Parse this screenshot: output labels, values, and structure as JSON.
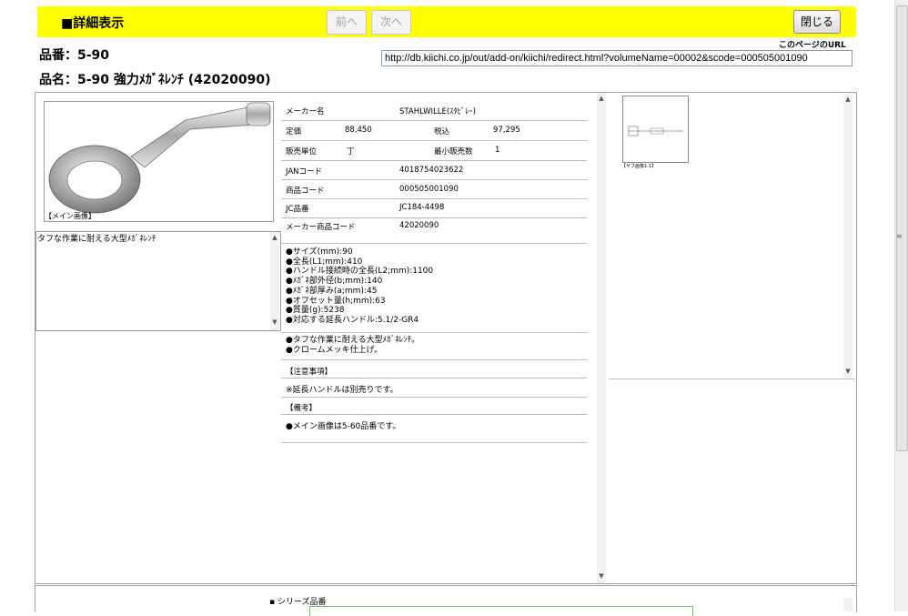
{
  "header": {
    "title": "■詳細表示",
    "prev_label": "前へ",
    "next_label": "次へ",
    "close_label": "閉じる"
  },
  "product": {
    "code_line": "品番：5-90",
    "name_line": "品名：5-90 強力ﾒｶﾞﾈﾚﾝﾁ (42020090)"
  },
  "page_url": {
    "label": "このページのURL",
    "value": "http://db.kiichi.co.jp/out/add-on/kiichi/redirect.html?volumeName=00002&scode=000505001090"
  },
  "main_image": {
    "caption": "【メイン画像】"
  },
  "description": "タフな作業に耐える大型ﾒｶﾞﾈﾚﾝﾁ",
  "details": {
    "maker_label": "メーカー名",
    "maker_value": "STAHLWILLE(ｽﾀﾋﾞﾚｰ)",
    "list_price_label": "定価",
    "list_price_value": "88,450",
    "tax_label": "税込",
    "tax_value": "97,295",
    "unit_label": "販売単位",
    "unit_value": "丁",
    "min_qty_label": "最小販売数",
    "min_qty_value": "1",
    "jan_label": "JANコード",
    "jan_value": "4018754023622",
    "item_code_label": "商品コード",
    "item_code_value": "000505001090",
    "jc_label": "JC品番",
    "jc_value": "JC184-4498",
    "maker_code_label": "メーカー商品コード",
    "maker_code_value": "42020090"
  },
  "specs": [
    "●サイズ(mm):90",
    "●全長(L1;mm):410",
    "●ハンドル接続時の全長(L2;mm):1100",
    "●ﾒｶﾞﾈ部外径(b;mm):140",
    "●ﾒｶﾞﾈ部厚み(a;mm):45",
    "●オフセット量(h;mm):63",
    "●質量(g):5238",
    "●対応する延長ハンドル:5.1/2-GR4"
  ],
  "features": [
    "●タフな作業に耐える大型ﾒｶﾞﾈﾚﾝﾁ。",
    "●クロームメッキ仕上げ。"
  ],
  "caution": {
    "title": "【注意事項】",
    "text": "※延長ハンドルは別売りです。"
  },
  "remarks": {
    "title": "【備考】",
    "text": "●メイン画像は5-60品番です。"
  },
  "sub_image": {
    "caption": "【サブ画像1-1】"
  },
  "series": {
    "label": "シリーズ品番"
  },
  "colors": {
    "header_bg": "#ffff00",
    "frame_border": "#a0a0a0",
    "series_table_border": "#6fbf6f"
  }
}
